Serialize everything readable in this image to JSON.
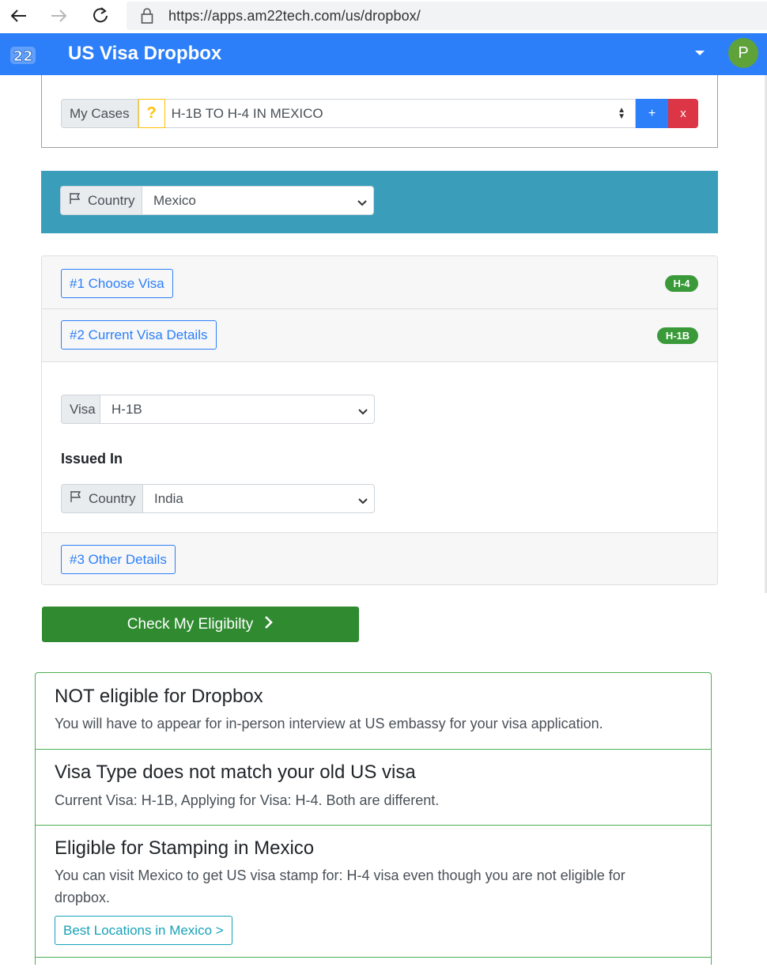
{
  "browser": {
    "url": "https://apps.am22tech.com/us/dropbox/"
  },
  "navbar": {
    "logo_text": "22",
    "title": "US Visa Dropbox",
    "avatar_letter": "P",
    "brand_color": "#2d7ff9"
  },
  "cases": {
    "label": "My Cases",
    "help_symbol": "?",
    "selected_case": "H-1B TO H-4 IN MEXICO",
    "add_label": "+",
    "remove_label": "x"
  },
  "country_filter": {
    "label": "Country",
    "selected": "Mexico"
  },
  "steps": {
    "choose_visa": {
      "label": "#1 Choose Visa",
      "badge": "H-4"
    },
    "current_visa": {
      "label": "#2 Current Visa Details",
      "badge": "H-1B"
    },
    "visa_field": {
      "label": "Visa",
      "selected": "H-1B"
    },
    "issued_in_heading": "Issued In",
    "issued_country": {
      "label": "Country",
      "selected": "India"
    },
    "other_details": {
      "label": "#3 Other Details"
    }
  },
  "eligibility_button": {
    "label": "Check My Eligibilty",
    "arrow": "›"
  },
  "results": [
    {
      "title": "NOT eligible for Dropbox",
      "text": "You will have to appear for in-person interview at US embassy for your visa application."
    },
    {
      "title": "Visa Type does not match your old US visa",
      "text": "Current Visa: H-1B, Applying for Visa: H-4. Both are different."
    },
    {
      "title": "Eligible for Stamping in Mexico",
      "text": "You can visit Mexico to get US visa stamp for: H-4 visa even though you are not eligible for dropbox.",
      "link_label": "Best Locations in Mexico >"
    }
  ],
  "colors": {
    "badge_green": "#3a9a3a",
    "band_teal": "#3a9ebb",
    "danger": "#dc3545",
    "warning": "#ffc107",
    "success_button": "#2f8a30",
    "info": "#17a2b8"
  }
}
